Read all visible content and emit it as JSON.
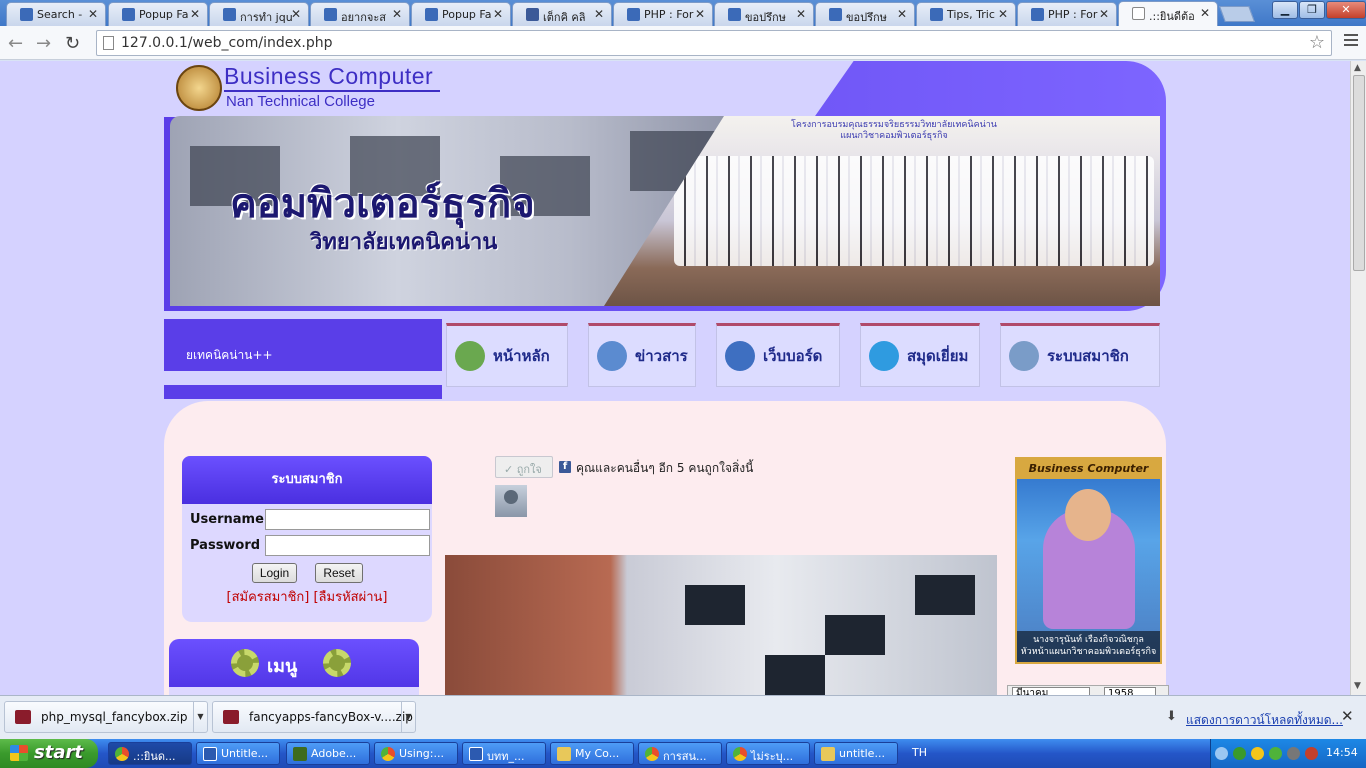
{
  "browser": {
    "tabs": [
      {
        "title": "Search -",
        "icon": "forum-icon"
      },
      {
        "title": "Popup Fa",
        "icon": "forum-icon"
      },
      {
        "title": "การทำ jqu",
        "icon": "forum-icon"
      },
      {
        "title": "อยากจะส",
        "icon": "forum-icon"
      },
      {
        "title": "Popup Fa",
        "icon": "forum-icon"
      },
      {
        "title": "เต็กคิ คลิ",
        "icon": "facebook-icon"
      },
      {
        "title": "PHP : For",
        "icon": "forum-icon"
      },
      {
        "title": "ขอปรึกษ",
        "icon": "forum-icon"
      },
      {
        "title": "ขอปรึกษ",
        "icon": "forum-icon"
      },
      {
        "title": "Tips, Tric",
        "icon": "forum-icon"
      },
      {
        "title": "PHP : For",
        "icon": "forum-icon"
      },
      {
        "title": ".::ยินดีต้อ",
        "icon": "page-icon",
        "active": true
      }
    ],
    "tab_close": "✕",
    "url": "127.0.0.1/web_com/index.php",
    "win_min": "▁",
    "win_max": "❐",
    "win_close": "✕",
    "back": "←",
    "forward": "→",
    "reload": "↻",
    "star": "☆"
  },
  "header": {
    "brand_title": "Business Computer",
    "brand_subtitle": "Nan Technical College",
    "banner_title": "คอมพิวเตอร์ธุรกิจ",
    "banner_subtitle": "วิทยาลัยเทคนิคน่าน",
    "photo_sign": "โครงการอบรมคุณธรรมจริยธรรมวิทยาลัยเทคนิคน่าน แผนกวิชาคอมพิวเตอร์ธุรกิจ",
    "ticker": "ยเทคนิคน่าน++"
  },
  "nav": [
    {
      "label": "หน้าหลัก",
      "icon": "home-icon",
      "color": "#6aa84f"
    },
    {
      "label": "ข่าวสาร",
      "icon": "news-icon",
      "color": "#5b8bd0"
    },
    {
      "label": "เว็บบอร์ด",
      "icon": "webboard-icon",
      "color": "#3e6fc1"
    },
    {
      "label": "สมุดเยี่ยม",
      "icon": "guestbook-icon",
      "color": "#2f9be0"
    },
    {
      "label": "ระบบสมาชิก",
      "icon": "member-icon",
      "color": "#7a9cc8"
    }
  ],
  "login": {
    "title": "ระบบสมาชิก",
    "username_label": "Username",
    "password_label": "Password",
    "username_value": "",
    "password_value": "",
    "login_button": "Login",
    "reset_button": "Reset",
    "links": "[สมัครสมาชิก] [ลืมรหัสผ่าน]"
  },
  "menu": {
    "title": "เมนู"
  },
  "facebook": {
    "like_button": "✓ ถูกใจ",
    "fb_letter": "f",
    "like_text": "คุณและคนอื่นๆ อีก 5 คนถูกใจสิ่งนี้"
  },
  "teacher": {
    "header": "Business Computer",
    "caption_name": "นางจารุนันท์ เรืองกิจวณิชกุล",
    "caption_role": "หัวหน้าแผนกวิชาคอมพิวเตอร์ธุรกิจ"
  },
  "calendar": {
    "month": "มีนาคม",
    "year": "1958"
  },
  "downloads": {
    "items": [
      {
        "name": "php_mysql_fancybox.zip"
      },
      {
        "name": "fancyapps-fancyBox-v....zip"
      }
    ],
    "show_all": "แสดงการดาวน์โหลดทั้งหมด...",
    "close": "✕",
    "dropdown": "▼",
    "show_all_icon": "⬇"
  },
  "taskbar": {
    "start": "start",
    "tasks": [
      {
        "label": ".::ยินด...",
        "icon": "chrome-icon",
        "active": true
      },
      {
        "label": "Untitle...",
        "icon": "document-icon"
      },
      {
        "label": "Adobe...",
        "icon": "dreamweaver-icon"
      },
      {
        "label": "Using:...",
        "icon": "chrome-icon"
      },
      {
        "label": "บทท_...",
        "icon": "word-icon"
      },
      {
        "label": "My Co...",
        "icon": "computer-icon"
      },
      {
        "label": "การสน...",
        "icon": "chrome-icon"
      },
      {
        "label": "ไม่ระบุ...",
        "icon": "chrome-icon"
      },
      {
        "label": "untitle...",
        "icon": "folder-icon"
      }
    ],
    "language": "TH",
    "clock": "14:54"
  }
}
